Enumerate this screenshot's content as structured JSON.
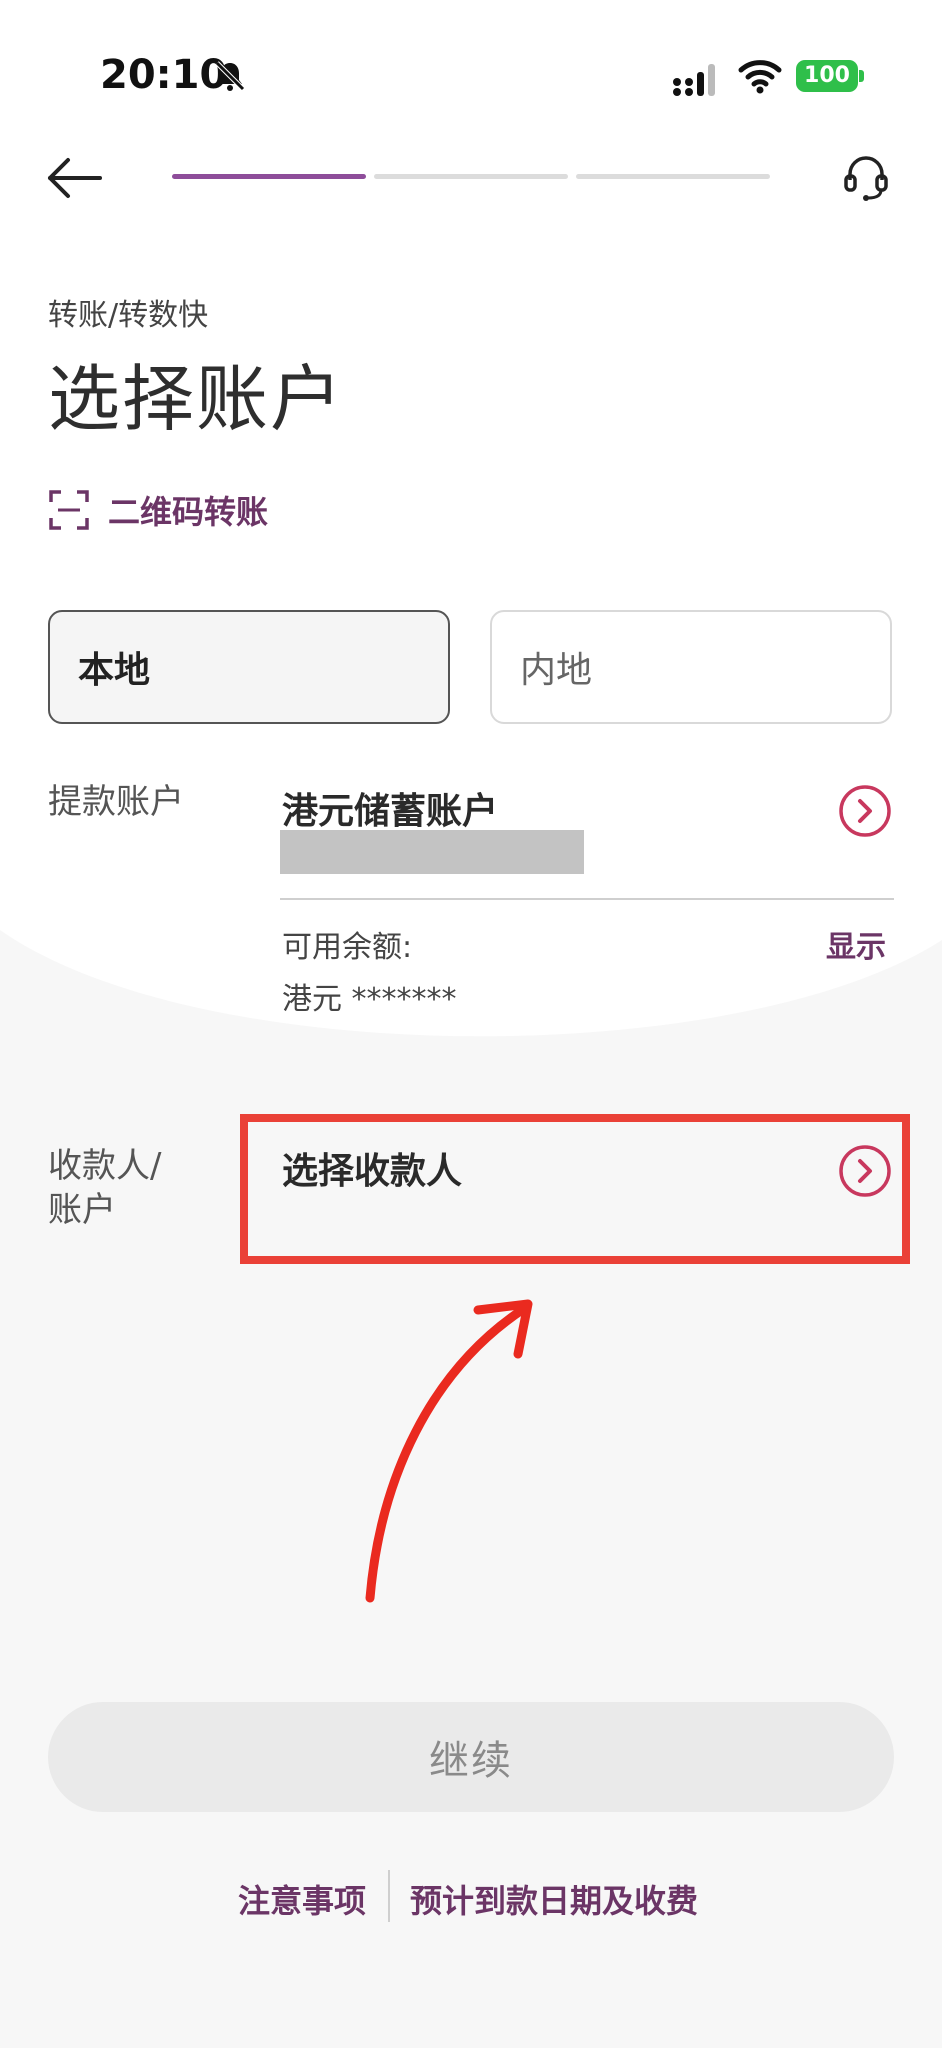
{
  "status_bar": {
    "time": "20:10",
    "battery": "100"
  },
  "breadcrumb": "转账/转数快",
  "page_title": "选择账户",
  "qr_transfer_label": "二维码转账",
  "segments": {
    "local": "本地",
    "mainland": "内地"
  },
  "debit_account": {
    "label": "提款账户",
    "name": "港元储蓄账户",
    "balance_label": "可用余额:",
    "show_label": "显示",
    "balance_value": "港元 *******"
  },
  "payee": {
    "label_line1": "收款人/",
    "label_line2": "账户",
    "placeholder": "选择收款人"
  },
  "continue_label": "继续",
  "footer": {
    "notes": "注意事项",
    "fees": "预计到款日期及收费"
  },
  "colors": {
    "brand_purple": "#8e4d9a",
    "link_purple": "#6b3566",
    "chevron": "#c8385e",
    "highlight_red": "#ea4137"
  }
}
